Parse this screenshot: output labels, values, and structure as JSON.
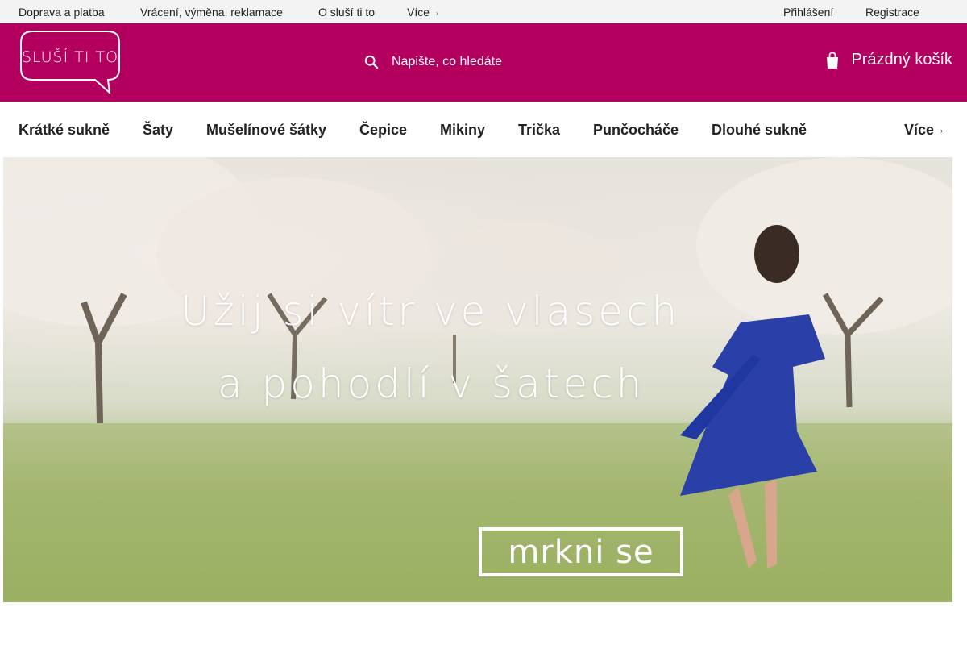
{
  "topbar": {
    "links": [
      "Doprava a platba",
      "Vrácení, výměna, reklamace",
      "O sluší ti to",
      "Více"
    ],
    "more_caret": "›",
    "login": "Přihlášení",
    "register": "Registrace"
  },
  "header": {
    "logo_text": "SLUŠÍ TI TO",
    "search_placeholder": "Napište, co hledáte",
    "cart_label": "Prázdný košík",
    "brand_color": "#b3005e"
  },
  "categories": {
    "items": [
      "Krátké sukně",
      "Šaty",
      "Mušelínové šátky",
      "Čepice",
      "Mikiny",
      "Trička",
      "Punčocháče",
      "Dlouhé sukně"
    ],
    "more": "Více",
    "more_caret": "›"
  },
  "hero": {
    "line1": "Užij si vítr ve vlasech",
    "line2": "a pohodlí v šatech",
    "button": "mrkni se"
  },
  "icons": {
    "search": "search-icon",
    "cart": "cart-icon",
    "caret": "chevron-down-icon"
  }
}
